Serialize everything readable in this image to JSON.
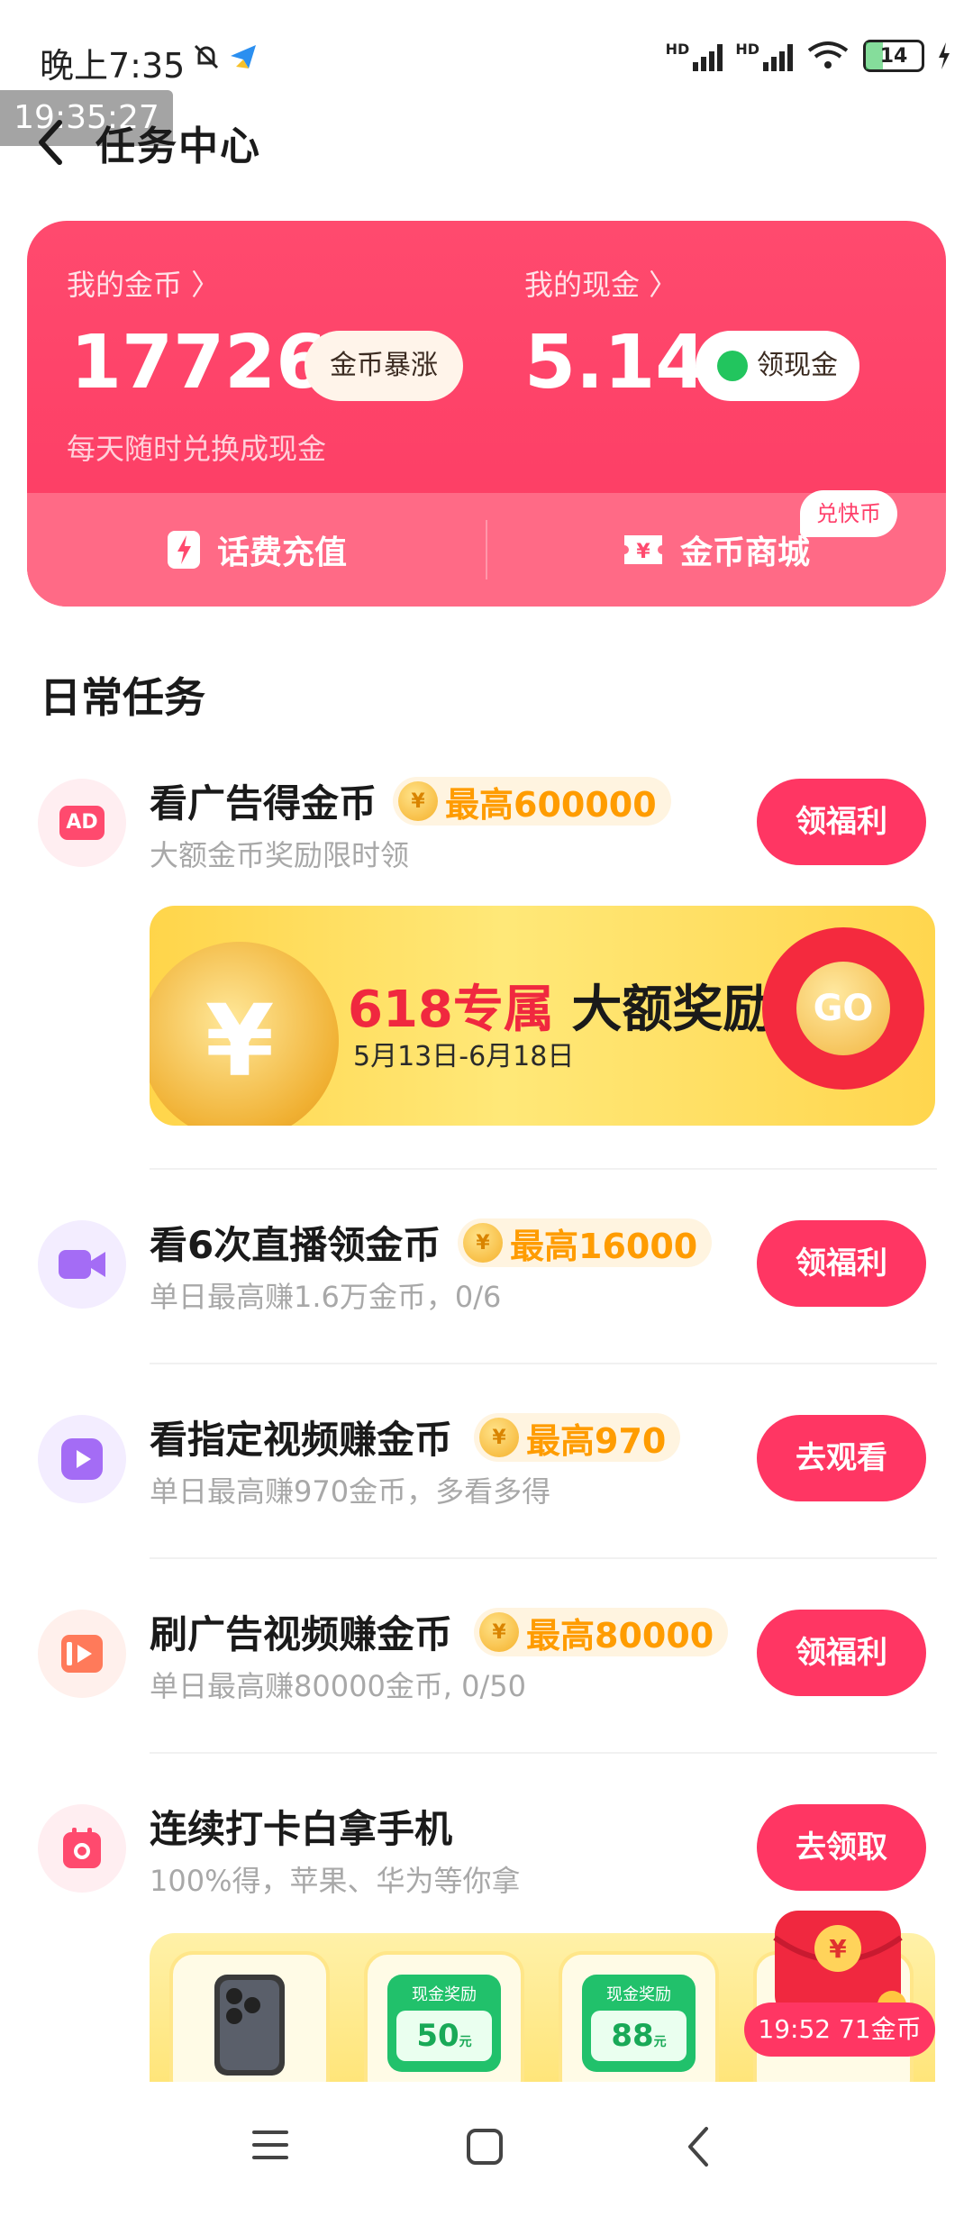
{
  "status_bar": {
    "time": "晚上7:35",
    "battery": "14",
    "network1": "HD",
    "network2": "HD",
    "wifi_sub": "6"
  },
  "overlay_clock": "19:35:27",
  "header": {
    "title": "任务中心"
  },
  "wallet": {
    "coins_label": "我的金币 〉",
    "coins_value": "17726",
    "coins_badge": "金币暴涨",
    "coins_hint": "每天随时兑换成现金",
    "cash_label": "我的现金 〉",
    "cash_value": "5.14",
    "cash_button": "领现金",
    "recharge_label": "话费充值",
    "mall_label": "金币商城",
    "mall_badge": "兑快币"
  },
  "section_title": "日常任务",
  "tasks": [
    {
      "title": "看广告得金币",
      "reward": "最高600000",
      "subtitle": "大额金币奖励限时领",
      "button": "领福利",
      "icon": "ad-icon",
      "icon_text": "AD"
    },
    {
      "title": "看6次直播领金币",
      "reward": "最高16000",
      "subtitle": "单日最高赚1.6万金币，0/6",
      "button": "领福利",
      "icon": "live-camera-icon"
    },
    {
      "title": "看指定视频赚金币",
      "reward": "最高970",
      "subtitle": "单日最高赚970金币，多看多得",
      "button": "去观看",
      "icon": "play-video-icon"
    },
    {
      "title": "刷广告视频赚金币",
      "reward": "最高80000",
      "subtitle": "单日最高赚80000金币, 0/50",
      "button": "领福利",
      "icon": "ad-video-icon"
    },
    {
      "title": "连续打卡白拿手机",
      "subtitle": "100%得，苹果、华为等你拿",
      "button": "去领取",
      "icon": "checkin-icon"
    }
  ],
  "banner": {
    "highlight": "618专属",
    "main": "大额奖励",
    "dates": "5月13日-6月18日",
    "go": "GO"
  },
  "prizes": [
    {
      "top": "现金奖励",
      "value": "50",
      "unit": "元"
    },
    {
      "top": "现金奖励",
      "value": "88",
      "unit": "元"
    }
  ],
  "float_tag": "19:52 71金币",
  "colors": {
    "accent": "#ff3663",
    "card": "#fc3b63",
    "reward": "#ff9c00"
  }
}
